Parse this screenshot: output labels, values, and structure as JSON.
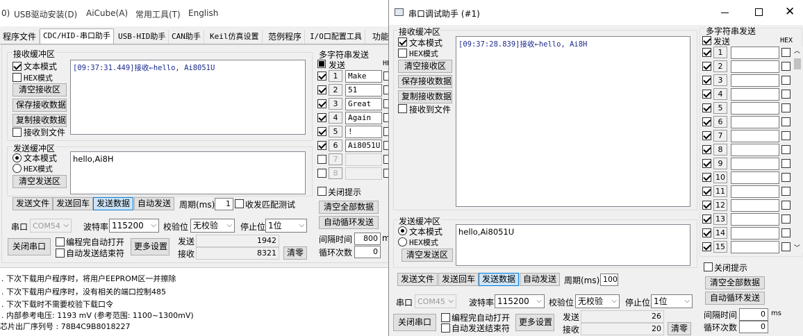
{
  "bg_app": {
    "menu": [
      "0)",
      "USB驱动安装(D)",
      "AiCube(A)",
      "常用工具(T)",
      "English"
    ],
    "tabs": [
      "程序文件",
      "CDC/HID-串口助手",
      "USB-HID助手",
      "CAN助手",
      "Keil仿真设置",
      "范例程序",
      "I/O口配置工具",
      "功能"
    ],
    "recv_group": "接收缓冲区",
    "recv_text_mode": "文本模式",
    "recv_hex_mode": "HEX模式",
    "clear_recv": "清空接收区",
    "save_recv": "保存接收数据",
    "copy_recv": "复制接收数据",
    "recv_to_file": "接收到文件",
    "recv_content": "[09:37:31.449]接收←hello, Ai8051U",
    "send_group": "发送缓冲区",
    "send_text_mode": "文本模式",
    "send_hex_mode": "HEX模式",
    "clear_send": "清空发送区",
    "send_content": "hello,Ai8H",
    "send_file": "发送文件",
    "send_cr": "发送回车",
    "send_data": "发送数据",
    "auto_send": "自动发送",
    "period_label": "周期(ms)",
    "period_value": "1",
    "match_test": "收发匹配测试",
    "port_label": "串口",
    "port_value": "COM54",
    "baud_label": "波特率",
    "baud_value": "115200",
    "parity_label": "校验位",
    "parity_value": "无校验",
    "stop_label": "停止位",
    "stop_value": "1位",
    "close_port": "关闭串口",
    "auto_open": "编程完自动打开",
    "auto_send_end": "自动发送结束符",
    "more_settings": "更多设置",
    "send_count_label": "发送",
    "send_count": "1942",
    "recv_count_label": "接收",
    "recv_count": "8321",
    "clear_counts": "清零",
    "multi_title": "多字符串发送",
    "multi_send": "发送",
    "multi_hex": "HE",
    "multi_rows": [
      {
        "n": "1",
        "text": "Make"
      },
      {
        "n": "2",
        "text": "51"
      },
      {
        "n": "3",
        "text": "Great"
      },
      {
        "n": "4",
        "text": "Again"
      },
      {
        "n": "5",
        "text": "!"
      },
      {
        "n": "6",
        "text": "Ai8051U"
      },
      {
        "n": "7",
        "text": ""
      },
      {
        "n": "8",
        "text": ""
      }
    ],
    "close_hint": "关闭提示",
    "clear_all": "清空全部数据",
    "auto_loop": "自动循环发送",
    "interval_label": "间隔时间",
    "interval_value": "800",
    "interval_unit": "m",
    "loop_label": "循环次数",
    "loop_value": "0",
    "log_lines": [
      ". 下次下载用户程序时，将用户EEPROM区一并擦除",
      ". 下次下载用户程序时，没有相关的端口控制485",
      ". 下次下载时不需要校验下载口令",
      ". 内部参考电压: 1193 mV (参考范围: 1100~1300mV)",
      "芯片出厂序列号 : 78B4C9B8018227"
    ]
  },
  "fg_window": {
    "title": "串口调试助手 (#1)",
    "recv_group": "接收缓冲区",
    "recv_text_mode": "文本模式",
    "recv_hex_mode": "HEX模式",
    "clear_recv": "清空接收区",
    "save_recv": "保存接收数据",
    "copy_recv": "复制接收数据",
    "recv_to_file": "接收到文件",
    "recv_content": "[09:37:28.839]接收←hello, Ai8H",
    "send_group": "发送缓冲区",
    "send_text_mode": "文本模式",
    "send_hex_mode": "HEX模式",
    "clear_send": "清空发送区",
    "send_content": "hello,Ai8051U",
    "send_file": "发送文件",
    "send_cr": "发送回车",
    "send_data": "发送数据",
    "auto_send": "自动发送",
    "period_label": "周期(ms)",
    "period_value": "100",
    "port_label": "串口",
    "port_value": "COM45",
    "baud_label": "波特率",
    "baud_value": "115200",
    "parity_label": "校验位",
    "parity_value": "无校验",
    "stop_label": "停止位",
    "stop_value": "1位",
    "close_port": "关闭串口",
    "auto_open": "编程完自动打开",
    "auto_send_end": "自动发送结束符",
    "more_settings": "更多设置",
    "send_count_label": "发送",
    "send_count": "26",
    "recv_count_label": "接收",
    "recv_count": "20",
    "clear_counts": "清零",
    "multi_title": "多字符串发送",
    "multi_send": "发送",
    "multi_hex": "HEX",
    "multi_rows": [
      "1",
      "2",
      "3",
      "4",
      "5",
      "6",
      "7",
      "8",
      "9",
      "10",
      "11",
      "12",
      "13",
      "14",
      "15"
    ],
    "close_hint": "关闭提示",
    "clear_all": "清空全部数据",
    "auto_loop": "自动循环发送",
    "interval_label": "间隔时间",
    "interval_value": "0",
    "interval_unit": "ms",
    "loop_label": "循环次数",
    "loop_value": "0"
  }
}
